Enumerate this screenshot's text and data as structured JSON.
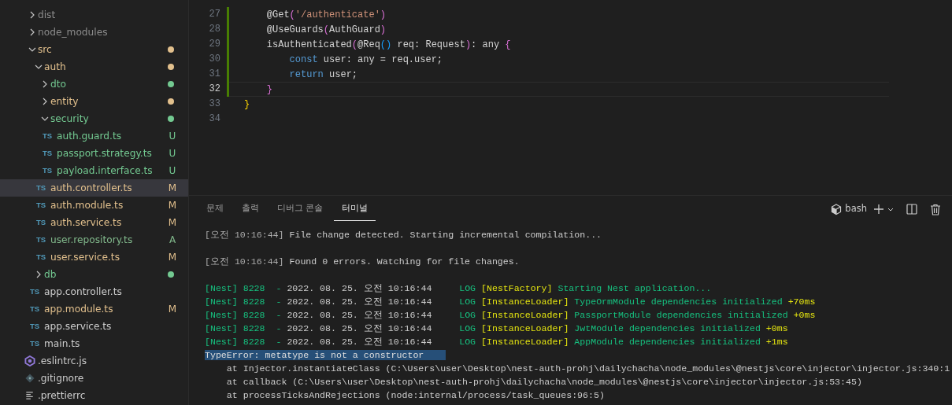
{
  "explorer": {
    "items": [
      {
        "kind": "folder",
        "name": "dist",
        "expanded": false,
        "color": "#8c8c8c"
      },
      {
        "kind": "folder",
        "name": "node_modules",
        "expanded": false,
        "color": "#8c8c8c"
      },
      {
        "kind": "folder",
        "name": "src",
        "expanded": true,
        "color": "#e2c08d",
        "children": [
          {
            "kind": "folder",
            "name": "auth",
            "expanded": true,
            "color": "#e2c08d",
            "children": [
              {
                "kind": "folder",
                "name": "dto",
                "expanded": false,
                "color": "#73c991"
              },
              {
                "kind": "folder",
                "name": "entity",
                "expanded": false,
                "color": "#e2c08d"
              },
              {
                "kind": "folder",
                "name": "security",
                "expanded": true,
                "color": "#73c991",
                "children": [
                  {
                    "kind": "ts",
                    "icon_label": "TS",
                    "name": "auth.guard.ts",
                    "color": "#73c991",
                    "badge": "U",
                    "selected": false
                  },
                  {
                    "kind": "ts",
                    "icon_label": "TS",
                    "name": "passport.strategy.ts",
                    "color": "#73c991",
                    "badge": "U",
                    "selected": false
                  },
                  {
                    "kind": "ts",
                    "icon_label": "TS",
                    "name": "payload.interface.ts",
                    "color": "#73c991",
                    "badge": "U",
                    "selected": false
                  }
                ]
              },
              {
                "kind": "ts",
                "icon_label": "TS",
                "name": "auth.controller.ts",
                "color": "#e2c08d",
                "badge": "M",
                "selected": true
              },
              {
                "kind": "ts",
                "icon_label": "TS",
                "name": "auth.module.ts",
                "color": "#e2c08d",
                "badge": "M",
                "selected": false
              },
              {
                "kind": "ts",
                "icon_label": "TS",
                "name": "auth.service.ts",
                "color": "#e2c08d",
                "badge": "M",
                "selected": false
              },
              {
                "kind": "ts",
                "icon_label": "TS",
                "name": "user.repository.ts",
                "color": "#81b88b",
                "badge": "A",
                "selected": false
              },
              {
                "kind": "ts",
                "icon_label": "TS",
                "name": "user.service.ts",
                "color": "#e2c08d",
                "badge": "M",
                "selected": false
              }
            ]
          },
          {
            "kind": "folder",
            "name": "db",
            "expanded": false,
            "color": "#73c991"
          },
          {
            "kind": "ts",
            "icon_label": "TS",
            "name": "app.controller.ts",
            "selected": false
          },
          {
            "kind": "ts",
            "icon_label": "TS",
            "name": "app.module.ts",
            "color": "#e2c08d",
            "badge": "M",
            "selected": false
          },
          {
            "kind": "ts",
            "icon_label": "TS",
            "name": "app.service.ts",
            "selected": false
          },
          {
            "kind": "ts",
            "icon_label": "TS",
            "name": "main.ts",
            "selected": false
          }
        ]
      },
      {
        "kind": "eslint",
        "name": ".eslintrc.js",
        "selected": false
      },
      {
        "kind": "git",
        "name": ".gitignore",
        "selected": false
      },
      {
        "kind": "config",
        "name": ".prettierrc",
        "selected": false
      }
    ]
  },
  "editor": {
    "lines": [
      {
        "number": "27",
        "modified": true,
        "current": false,
        "tokens": [
          {
            "kind": "plain",
            "text": "    @Get"
          },
          {
            "kind": "paren",
            "text": "("
          },
          {
            "kind": "string",
            "text": "'/authenticate'"
          },
          {
            "kind": "paren",
            "text": ")"
          }
        ]
      },
      {
        "number": "28",
        "modified": true,
        "current": false,
        "tokens": [
          {
            "kind": "plain",
            "text": "    @UseGuards"
          },
          {
            "kind": "paren",
            "text": "("
          },
          {
            "kind": "plain",
            "text": "AuthGuard"
          },
          {
            "kind": "paren",
            "text": ")"
          }
        ]
      },
      {
        "number": "29",
        "modified": true,
        "current": false,
        "tokens": [
          {
            "kind": "plain",
            "text": "    isAuthenticated"
          },
          {
            "kind": "paren",
            "text": "("
          },
          {
            "kind": "plain",
            "text": "@Req"
          },
          {
            "kind": "paren2",
            "text": "()"
          },
          {
            "kind": "plain",
            "text": " req: Request"
          },
          {
            "kind": "paren",
            "text": ")"
          },
          {
            "kind": "plain",
            "text": ": any "
          },
          {
            "kind": "paren",
            "text": "{"
          }
        ]
      },
      {
        "number": "30",
        "modified": true,
        "current": false,
        "tokens": [
          {
            "kind": "keyword",
            "text": "        const"
          },
          {
            "kind": "plain",
            "text": " user: any = req.user;"
          }
        ]
      },
      {
        "number": "31",
        "modified": true,
        "current": false,
        "tokens": [
          {
            "kind": "keyword",
            "text": "        return"
          },
          {
            "kind": "plain",
            "text": " user;"
          }
        ]
      },
      {
        "number": "32",
        "modified": true,
        "current": true,
        "tokens": [
          {
            "kind": "paren",
            "text": "    }"
          }
        ]
      },
      {
        "number": "33",
        "modified": false,
        "current": false,
        "tokens": [
          {
            "kind": "brace",
            "text": "}"
          }
        ]
      },
      {
        "number": "34",
        "modified": false,
        "current": false
      }
    ]
  },
  "panel": {
    "tabs": [
      {
        "label": "문제",
        "selected": false
      },
      {
        "label": "출력",
        "selected": false
      },
      {
        "label": "디버그 콘솔",
        "selected": false
      },
      {
        "label": "터미널",
        "selected": true
      }
    ],
    "shell": "bash",
    "terminal": [
      {
        "tokens": [
          {
            "kind": "dim",
            "text": "[오전 10:16:44]"
          },
          {
            "kind": "plain",
            "text": " File change detected. Starting incremental compilation..."
          }
        ]
      },
      {
        "kind": "blank"
      },
      {
        "tokens": [
          {
            "kind": "dim",
            "text": "[오전 10:16:44]"
          },
          {
            "kind": "plain",
            "text": " Found 0 errors. Watching for file changes."
          }
        ]
      },
      {
        "kind": "blank"
      },
      {
        "tokens": [
          {
            "kind": "green",
            "text": "[Nest] 8228  - "
          },
          {
            "kind": "plain",
            "text": "2022. 08. 25. 오전 10:16:44"
          },
          {
            "kind": "green",
            "text": "     LOG "
          },
          {
            "kind": "yellow",
            "text": "[NestFactory]"
          },
          {
            "kind": "green",
            "text": " Starting Nest application..."
          }
        ]
      },
      {
        "tokens": [
          {
            "kind": "green",
            "text": "[Nest] 8228  - "
          },
          {
            "kind": "plain",
            "text": "2022. 08. 25. 오전 10:16:44"
          },
          {
            "kind": "green",
            "text": "     LOG "
          },
          {
            "kind": "yellow",
            "text": "[InstanceLoader]"
          },
          {
            "kind": "green",
            "text": " TypeOrmModule dependencies initialized "
          },
          {
            "kind": "yellow",
            "text": "+70ms"
          }
        ]
      },
      {
        "tokens": [
          {
            "kind": "green",
            "text": "[Nest] 8228  - "
          },
          {
            "kind": "plain",
            "text": "2022. 08. 25. 오전 10:16:44"
          },
          {
            "kind": "green",
            "text": "     LOG "
          },
          {
            "kind": "yellow",
            "text": "[InstanceLoader]"
          },
          {
            "kind": "green",
            "text": " PassportModule dependencies initialized "
          },
          {
            "kind": "yellow",
            "text": "+0ms"
          }
        ]
      },
      {
        "tokens": [
          {
            "kind": "green",
            "text": "[Nest] 8228  - "
          },
          {
            "kind": "plain",
            "text": "2022. 08. 25. 오전 10:16:44"
          },
          {
            "kind": "green",
            "text": "     LOG "
          },
          {
            "kind": "yellow",
            "text": "[InstanceLoader]"
          },
          {
            "kind": "green",
            "text": " JwtModule dependencies initialized "
          },
          {
            "kind": "yellow",
            "text": "+0ms"
          }
        ]
      },
      {
        "tokens": [
          {
            "kind": "green",
            "text": "[Nest] 8228  - "
          },
          {
            "kind": "plain",
            "text": "2022. 08. 25. 오전 10:16:44"
          },
          {
            "kind": "green",
            "text": "     LOG "
          },
          {
            "kind": "yellow",
            "text": "[InstanceLoader]"
          },
          {
            "kind": "green",
            "text": " AppModule dependencies initialized "
          },
          {
            "kind": "yellow",
            "text": "+1ms"
          }
        ]
      },
      {
        "tokens": [
          {
            "kind": "highlight",
            "text": "TypeError: metatype is not a constructor    "
          }
        ]
      },
      {
        "tokens": [
          {
            "kind": "plain",
            "text": "    at Injector.instantiateClass (C:\\Users\\user\\Desktop\\nest-auth-prohj\\dailychacha\\node_modules\\@nestjs\\core\\injector\\injector.js:340:1"
          }
        ]
      },
      {
        "tokens": [
          {
            "kind": "plain",
            "text": "    at callback (C:\\Users\\user\\Desktop\\nest-auth-prohj\\dailychacha\\node_modules\\@nestjs\\core\\injector\\injector.js:53:45)"
          }
        ]
      },
      {
        "tokens": [
          {
            "kind": "plain",
            "text": "    at processTicksAndRejections (node:internal/process/task_queues:96:5)"
          }
        ]
      }
    ]
  }
}
